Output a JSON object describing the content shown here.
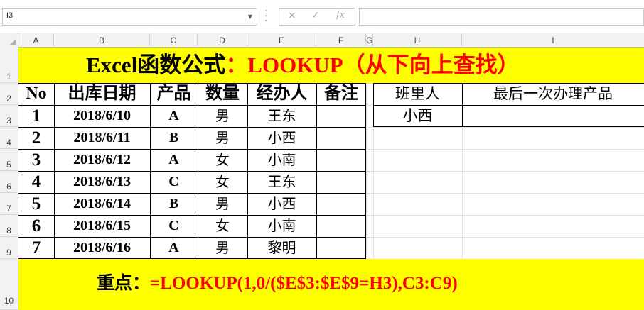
{
  "formula_bar": {
    "name_box": "I3",
    "cancel_icon": "×",
    "enter_icon": "✓",
    "fx_label": "fx",
    "formula": ""
  },
  "columns": [
    "A",
    "B",
    "C",
    "D",
    "E",
    "F",
    "G",
    "H",
    "I"
  ],
  "rows": [
    "1",
    "2",
    "3",
    "4",
    "5",
    "6",
    "7",
    "8",
    "9",
    "10"
  ],
  "title": {
    "black_part": "Excel函数公式",
    "red_part": "：LOOKUP（从下向上查找）"
  },
  "table": {
    "headers": [
      "No",
      "出库日期",
      "产品",
      "数量",
      "经办人",
      "备注"
    ],
    "rows": [
      {
        "no": "1",
        "date": "2018/6/10",
        "product": "A",
        "qty": "男",
        "handler": "王东",
        "note": ""
      },
      {
        "no": "2",
        "date": "2018/6/11",
        "product": "B",
        "qty": "男",
        "handler": "小西",
        "note": ""
      },
      {
        "no": "3",
        "date": "2018/6/12",
        "product": "A",
        "qty": "女",
        "handler": "小南",
        "note": ""
      },
      {
        "no": "4",
        "date": "2018/6/13",
        "product": "C",
        "qty": "女",
        "handler": "王东",
        "note": ""
      },
      {
        "no": "5",
        "date": "2018/6/14",
        "product": "B",
        "qty": "男",
        "handler": "小西",
        "note": ""
      },
      {
        "no": "6",
        "date": "2018/6/15",
        "product": "C",
        "qty": "女",
        "handler": "小南",
        "note": ""
      },
      {
        "no": "7",
        "date": "2018/6/16",
        "product": "A",
        "qty": "男",
        "handler": "黎明",
        "note": ""
      }
    ]
  },
  "lookup": {
    "header_person": "班里人",
    "header_result": "最后一次办理产品",
    "person": "小西",
    "result": ""
  },
  "footer": {
    "black_part": "重点：",
    "red_part": "=LOOKUP(1,0/($E$3:$E$9=H3),C3:C9)"
  },
  "colors": {
    "band": "#ffff00",
    "red_text": "#ff0000",
    "black_text": "#000000"
  }
}
